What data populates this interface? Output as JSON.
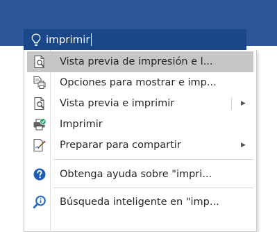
{
  "search": {
    "query": "imprimir"
  },
  "menu": {
    "items": [
      {
        "label": "Vista previa de impresión e l...",
        "icon": "print-preview-icon",
        "selected": true,
        "submenu": false
      },
      {
        "label": "Opciones para mostrar e imp...",
        "icon": "print-options-icon",
        "selected": false,
        "submenu": false
      },
      {
        "label": "Vista previa e imprimir",
        "icon": "print-preview-icon",
        "selected": false,
        "submenu": true
      },
      {
        "label": "Imprimir",
        "icon": "printer-icon",
        "selected": false,
        "submenu": false
      },
      {
        "label": "Preparar para compartir",
        "icon": "prepare-share-icon",
        "selected": false,
        "submenu": true
      },
      {
        "label": "Obtenga ayuda sobre \"impri...",
        "icon": "help-icon",
        "selected": false,
        "submenu": false
      },
      {
        "label": "Búsqueda inteligente en \"imp...",
        "icon": "smart-lookup-icon",
        "selected": false,
        "submenu": false
      }
    ],
    "submenu_arrow": "▶"
  },
  "colors": {
    "ribbon": "#2b579a",
    "search_box": "#19478a",
    "selected_item": "#c6c6c6",
    "help_blue": "#1e5eb4",
    "smart_lookup_blue": "#2b6cc4"
  }
}
